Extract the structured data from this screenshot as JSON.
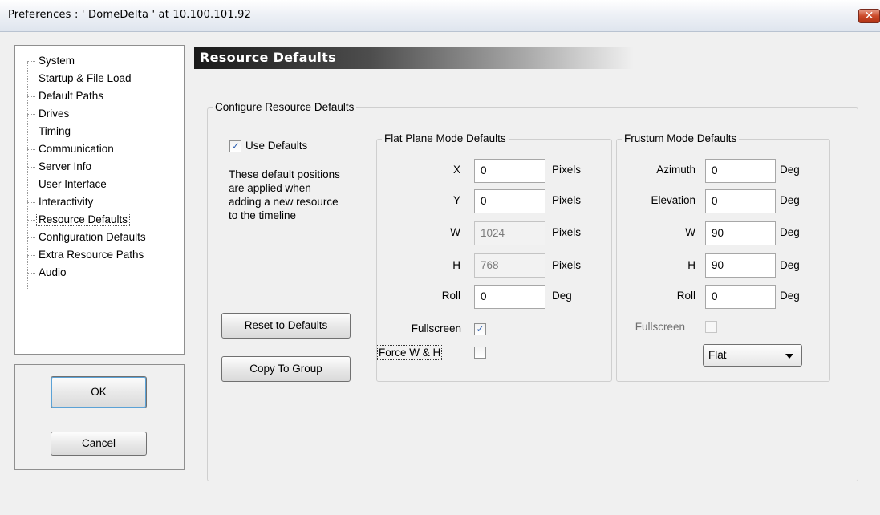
{
  "window": {
    "title": "Preferences  :  ' DomeDelta ' at  10.100.101.92",
    "close_glyph": "✕"
  },
  "tree": {
    "items": [
      {
        "label": "System"
      },
      {
        "label": "Startup & File Load"
      },
      {
        "label": "Default Paths"
      },
      {
        "label": "Drives"
      },
      {
        "label": "Timing"
      },
      {
        "label": "Communication"
      },
      {
        "label": "Server Info"
      },
      {
        "label": "User Interface"
      },
      {
        "label": "Interactivity"
      },
      {
        "label": "Resource Defaults",
        "selected": true
      },
      {
        "label": "Configuration Defaults"
      },
      {
        "label": "Extra Resource Paths"
      },
      {
        "label": "Audio"
      }
    ]
  },
  "buttons": {
    "ok": "OK",
    "cancel": "Cancel",
    "reset": "Reset to Defaults",
    "copy": "Copy To Group"
  },
  "panel": {
    "title": "Resource Defaults",
    "configure_legend": "Configure Resource Defaults",
    "use_defaults": {
      "label": "Use Defaults",
      "checked": true
    },
    "description": [
      "These default positions",
      "are applied when",
      "adding a new resource",
      "to the timeline"
    ]
  },
  "flat": {
    "legend": "Flat Plane Mode Defaults",
    "rows": [
      {
        "label": "X",
        "value": "0",
        "unit": "Pixels",
        "disabled": false
      },
      {
        "label": "Y",
        "value": "0",
        "unit": "Pixels",
        "disabled": false
      },
      {
        "label": "W",
        "value": "1024",
        "unit": "Pixels",
        "disabled": true
      },
      {
        "label": "H",
        "value": "768",
        "unit": "Pixels",
        "disabled": true
      },
      {
        "label": "Roll",
        "value": "0",
        "unit": "Deg",
        "disabled": false
      }
    ],
    "fullscreen": {
      "label": "Fullscreen",
      "checked": true
    },
    "force_wh": {
      "label": "Force W & H",
      "checked": false
    }
  },
  "frustum": {
    "legend": "Frustum Mode Defaults",
    "rows": [
      {
        "label": "Azimuth",
        "value": "0",
        "unit": "Deg"
      },
      {
        "label": "Elevation",
        "value": "0",
        "unit": "Deg"
      },
      {
        "label": "W",
        "value": "90",
        "unit": "Deg"
      },
      {
        "label": "H",
        "value": "90",
        "unit": "Deg"
      },
      {
        "label": "Roll",
        "value": "0",
        "unit": "Deg"
      }
    ],
    "fullscreen": {
      "label": "Fullscreen",
      "checked": false,
      "disabled": true
    },
    "mode_select": "Flat"
  },
  "colors": {
    "header_band": "#1a1a1a",
    "close_button": "#cc4a2a",
    "check_mark": "#2a5db0"
  }
}
